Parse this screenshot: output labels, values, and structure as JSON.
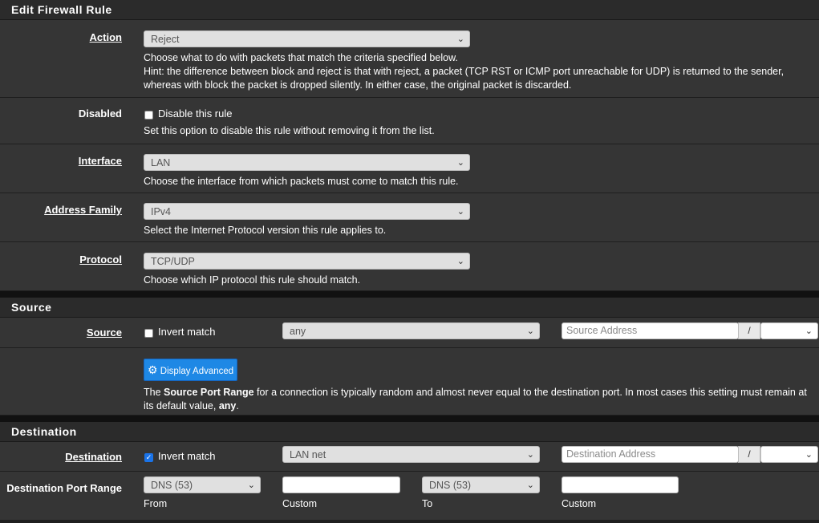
{
  "sections": {
    "edit": "Edit Firewall Rule",
    "source": "Source",
    "destination": "Destination"
  },
  "action": {
    "label": "Action",
    "value": "Reject",
    "help1": "Choose what to do with packets that match the criteria specified below.",
    "help2": "Hint: the difference between block and reject is that with reject, a packet (TCP RST or ICMP port unreachable for UDP) is returned to the sender,",
    "help3": "whereas with block the packet is dropped silently. In either case, the original packet is discarded."
  },
  "disabled": {
    "label": "Disabled",
    "checkbox_label": "Disable this rule",
    "checked": false,
    "help": "Set this option to disable this rule without removing it from the list."
  },
  "interface": {
    "label": "Interface",
    "value": "LAN",
    "help": "Choose the interface from which packets must come to match this rule."
  },
  "address_family": {
    "label": "Address Family",
    "value": "IPv4",
    "help": "Select the Internet Protocol version this rule applies to."
  },
  "protocol": {
    "label": "Protocol",
    "value": "TCP/UDP",
    "help": "Choose which IP protocol this rule should match."
  },
  "source": {
    "label": "Source",
    "invert_label": "Invert match",
    "invert_checked": false,
    "type_value": "any",
    "address_placeholder": "Source Address",
    "slash": "/",
    "advanced_button": "Display Advanced",
    "help_pre": "The ",
    "help_bold": "Source Port Range",
    "help_mid": " for a connection is typically random and almost never equal to the destination port. In most cases this setting must remain at",
    "help_line2_pre": "its default value, ",
    "help_line2_bold": "any",
    "help_line2_post": "."
  },
  "destination": {
    "label": "Destination",
    "invert_label": "Invert match",
    "invert_checked": true,
    "type_value": "LAN net",
    "address_placeholder": "Destination Address",
    "slash": "/"
  },
  "dest_port": {
    "label": "Destination Port Range",
    "from_value": "DNS (53)",
    "from_label": "From",
    "custom_label": "Custom",
    "to_value": "DNS (53)",
    "to_label": "To",
    "custom2_label": "Custom"
  },
  "icons": {
    "chevron": "chevron-down-icon",
    "gear": "gear-icon",
    "check": "check-icon"
  },
  "colors": {
    "button": "#1e88e5",
    "checkbox_on": "#1a73e8"
  }
}
